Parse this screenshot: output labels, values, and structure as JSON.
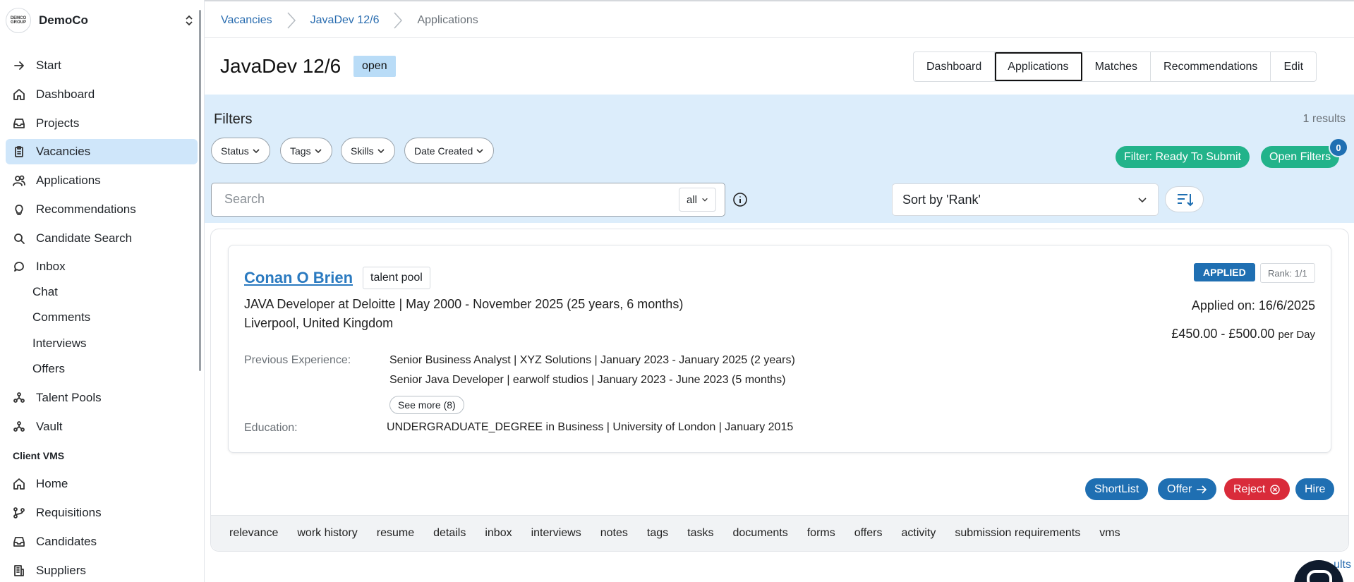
{
  "org": {
    "name": "DemoCo",
    "logo_text": "DEMCO GROUP"
  },
  "sidebar": {
    "items": [
      {
        "label": "Start",
        "icon": "arrow-right-icon"
      },
      {
        "label": "Dashboard",
        "icon": "home-icon"
      },
      {
        "label": "Projects",
        "icon": "inbox-tray-icon"
      },
      {
        "label": "Vacancies",
        "icon": "clipboard-icon",
        "active": true
      },
      {
        "label": "Applications",
        "icon": "users-icon"
      },
      {
        "label": "Recommendations",
        "icon": "lightbulb-icon"
      },
      {
        "label": "Candidate Search",
        "icon": "search-icon"
      },
      {
        "label": "Inbox",
        "icon": "chat-icon"
      }
    ],
    "inbox_sub": [
      "Chat",
      "Comments",
      "Interviews",
      "Offers"
    ],
    "items2": [
      {
        "label": "Talent Pools",
        "icon": "network-icon"
      },
      {
        "label": "Vault",
        "icon": "network-icon"
      }
    ],
    "section_label": "Client VMS",
    "items3": [
      {
        "label": "Home",
        "icon": "home-icon"
      },
      {
        "label": "Requisitions",
        "icon": "branch-icon"
      },
      {
        "label": "Candidates",
        "icon": "inbox-tray-icon"
      },
      {
        "label": "Suppliers",
        "icon": "building-icon"
      }
    ]
  },
  "breadcrumb": [
    "Vacancies",
    "JavaDev 12/6",
    "Applications"
  ],
  "page": {
    "title": "JavaDev 12/6",
    "status": "open"
  },
  "view_tabs": [
    "Dashboard",
    "Applications",
    "Matches",
    "Recommendations",
    "Edit"
  ],
  "filters": {
    "title": "Filters",
    "results": "1 results",
    "chips": [
      "Status",
      "Tags",
      "Skills",
      "Date Created"
    ],
    "ready_label": "Filter: Ready To Submit",
    "open_label": "Open Filters",
    "open_count": "0",
    "search_placeholder": "Search",
    "search_scope": "all",
    "sort_label": "Sort by 'Rank'"
  },
  "candidate": {
    "name": "Conan O Brien",
    "tag": "talent pool",
    "current_role": "JAVA Developer at Deloitte | May 2000 - November 2025 (25 years, 6 months)",
    "location": "Liverpool, United Kingdom",
    "status": "APPLIED",
    "rank": "Rank: 1/1",
    "applied_on": "Applied on: 16/6/2025",
    "rate": "£450.00 - £500.00",
    "rate_unit": "per Day",
    "prev_label": "Previous Experience:",
    "experience": [
      "Senior Business Analyst | XYZ Solutions | January 2023 - January 2025 (2 years)",
      "Senior Java Developer | earwolf studios | January 2023 - June 2023 (5 months)"
    ],
    "see_more": "See more (8)",
    "edu_label": "Education:",
    "education": "UNDERGRADUATE_DEGREE in Business | University of London | January 2015"
  },
  "actions": {
    "shortlist": "ShortList",
    "offer": "Offer",
    "reject": "Reject",
    "hire": "Hire"
  },
  "detail_tabs": [
    "relevance",
    "work history",
    "resume",
    "details",
    "inbox",
    "interviews",
    "notes",
    "tags",
    "tasks",
    "documents",
    "forms",
    "offers",
    "activity",
    "submission requirements",
    "vms"
  ],
  "peek_text": "ults",
  "colors": {
    "accent": "#1f6fb2",
    "green": "#22b38a",
    "red": "#d92b3a",
    "filter_band": "#dcedfb",
    "active_nav": "#cfe6fa"
  }
}
